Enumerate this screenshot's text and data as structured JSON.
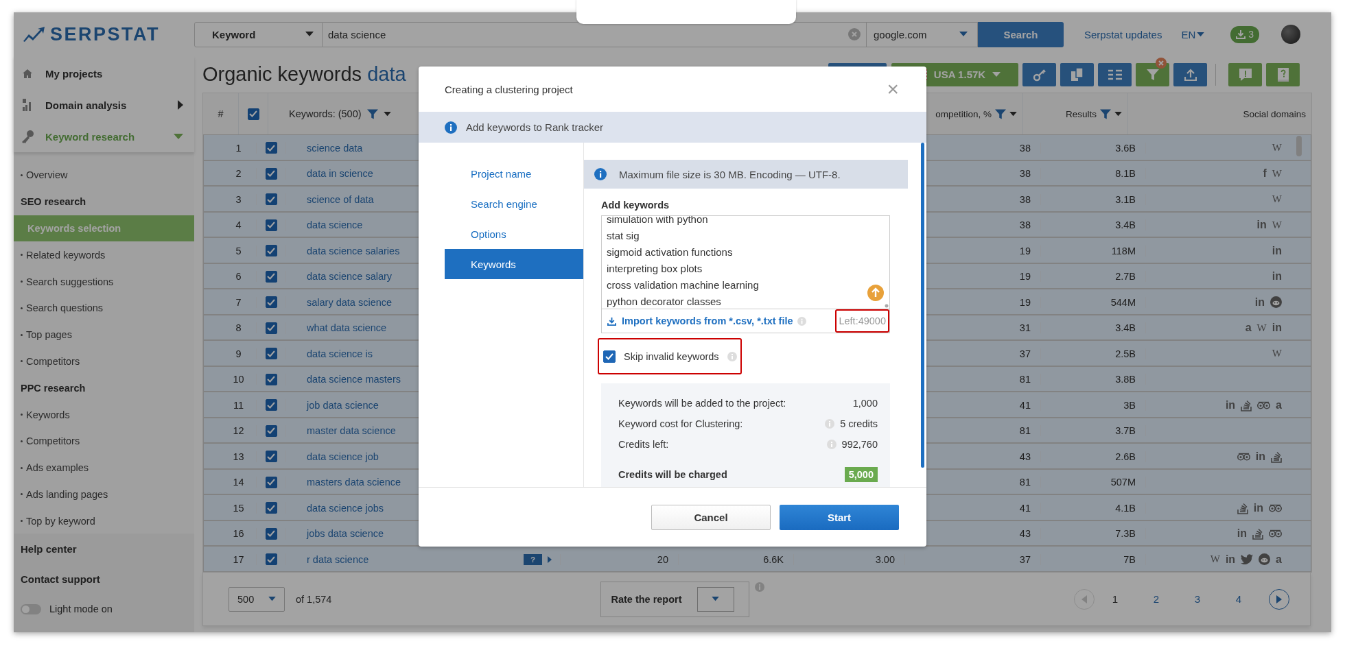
{
  "header": {
    "logo": "SERPSTAT",
    "search_type": "Keyword",
    "query": "data science",
    "engine": "google.com",
    "search_button": "Search",
    "updates_link": "Serpstat updates",
    "language": "EN",
    "downloads_count": "3"
  },
  "sidebar": {
    "items": [
      {
        "label": "My projects",
        "kind": "link",
        "expanded": false
      },
      {
        "label": "Domain analysis",
        "kind": "menu",
        "expanded": false
      },
      {
        "label": "Keyword research",
        "kind": "menu",
        "expanded": true
      }
    ],
    "subitems": [
      {
        "kind": "link",
        "label": "Overview",
        "selected": false
      },
      {
        "kind": "section",
        "label": "SEO research"
      },
      {
        "kind": "link",
        "label": "Keywords selection",
        "selected": true
      },
      {
        "kind": "link",
        "label": "Related keywords",
        "selected": false
      },
      {
        "kind": "link",
        "label": "Search suggestions",
        "selected": false
      },
      {
        "kind": "link",
        "label": "Search questions",
        "selected": false
      },
      {
        "kind": "link",
        "label": "Top pages",
        "selected": false
      },
      {
        "kind": "link",
        "label": "Competitors",
        "selected": false
      },
      {
        "kind": "section",
        "label": "PPC research"
      },
      {
        "kind": "link",
        "label": "Keywords",
        "selected": false
      },
      {
        "kind": "link",
        "label": "Competitors",
        "selected": false
      },
      {
        "kind": "link",
        "label": "Ads examples",
        "selected": false
      },
      {
        "kind": "link",
        "label": "Ads landing pages",
        "selected": false
      },
      {
        "kind": "link",
        "label": "Top by keyword",
        "selected": false
      }
    ],
    "bottom_links": [
      "Help center",
      "Contact support"
    ],
    "light_mode": {
      "label": "Light mode on",
      "on": false
    }
  },
  "page": {
    "title": "Organic keywords",
    "title_query": "data",
    "toolbar": [
      {
        "kind": "tool",
        "active": false,
        "removable": false
      },
      {
        "kind": "region",
        "label": "USA 1.57K",
        "active": true,
        "removable": false
      },
      {
        "kind": "tool",
        "active": false,
        "removable": false
      },
      {
        "kind": "tool",
        "active": false,
        "removable": false
      },
      {
        "kind": "tool",
        "active": false,
        "removable": false
      },
      {
        "kind": "tool",
        "active": true,
        "removable": true
      },
      {
        "kind": "tool",
        "active": false,
        "removable": false
      },
      {
        "kind": "support",
        "active": true,
        "removable": false
      },
      {
        "kind": "support",
        "active": true,
        "removable": false
      }
    ]
  },
  "table": {
    "columns": {
      "number": "#",
      "all_checked": true,
      "keywords": "Keywords: (500)",
      "competition": "ompetition, %",
      "results": "Results",
      "social": "Social domains"
    },
    "rows": [
      {
        "n": "1",
        "checked": true,
        "keyword": "science data",
        "competition": "38",
        "results": "3.6B",
        "social": [
          {
            "kind": "letter",
            "text": "W"
          }
        ]
      },
      {
        "n": "2",
        "checked": true,
        "keyword": "data in science",
        "competition": "38",
        "results": "8.1B",
        "social": [
          {
            "kind": "letter",
            "text": "f"
          },
          {
            "kind": "letter",
            "text": "W"
          }
        ]
      },
      {
        "n": "3",
        "checked": true,
        "keyword": "science of data",
        "competition": "38",
        "results": "3.1B",
        "social": [
          {
            "kind": "letter",
            "text": "W"
          }
        ]
      },
      {
        "n": "4",
        "checked": true,
        "keyword": "data science",
        "competition": "38",
        "results": "3.4B",
        "social": [
          {
            "kind": "letter",
            "text": "in"
          },
          {
            "kind": "letter",
            "text": "W"
          }
        ]
      },
      {
        "n": "5",
        "checked": true,
        "keyword": "data science salaries",
        "competition": "19",
        "results": "118M",
        "social": [
          {
            "kind": "letter",
            "text": "in"
          }
        ]
      },
      {
        "n": "6",
        "checked": true,
        "keyword": "data science salary",
        "competition": "19",
        "results": "2.7B",
        "social": [
          {
            "kind": "letter",
            "text": "in"
          }
        ]
      },
      {
        "n": "7",
        "checked": true,
        "keyword": "salary data science",
        "competition": "19",
        "results": "544M",
        "social": [
          {
            "kind": "letter",
            "text": "in"
          },
          {
            "kind": "alien"
          }
        ]
      },
      {
        "n": "8",
        "checked": true,
        "keyword": "what data science",
        "competition": "31",
        "results": "3.4B",
        "social": [
          {
            "kind": "letter",
            "text": "a"
          },
          {
            "kind": "letter",
            "text": "W"
          },
          {
            "kind": "letter",
            "text": "in"
          }
        ]
      },
      {
        "n": "9",
        "checked": true,
        "keyword": "data science is",
        "competition": "37",
        "results": "2.5B",
        "social": [
          {
            "kind": "letter",
            "text": "W"
          }
        ]
      },
      {
        "n": "10",
        "checked": true,
        "keyword": "data science masters",
        "competition": "81",
        "results": "3.8B"
      },
      {
        "n": "11",
        "checked": true,
        "keyword": "job data science",
        "competition": "41",
        "results": "3B",
        "social": [
          {
            "kind": "letter",
            "text": "in"
          },
          {
            "kind": "stack"
          },
          {
            "kind": "owl"
          },
          {
            "kind": "letter",
            "text": "a"
          }
        ]
      },
      {
        "n": "12",
        "checked": true,
        "keyword": "master data science",
        "competition": "81",
        "results": "3.7B"
      },
      {
        "n": "13",
        "checked": true,
        "keyword": "data science job",
        "competition": "43",
        "results": "2.6B",
        "social": [
          {
            "kind": "owl"
          },
          {
            "kind": "letter",
            "text": "in"
          },
          {
            "kind": "stack"
          }
        ]
      },
      {
        "n": "14",
        "checked": true,
        "keyword": "masters data science",
        "competition": "81",
        "results": "507M"
      },
      {
        "n": "15",
        "checked": true,
        "keyword": "data science jobs",
        "competition": "41",
        "results": "4.1B",
        "social": [
          {
            "kind": "stack"
          },
          {
            "kind": "letter",
            "text": "in"
          },
          {
            "kind": "owl"
          }
        ]
      },
      {
        "n": "16",
        "checked": true,
        "keyword": "jobs data science",
        "competition": "43",
        "results": "7.3B",
        "social": [
          {
            "kind": "letter",
            "text": "in"
          },
          {
            "kind": "stack"
          },
          {
            "kind": "owl"
          }
        ]
      },
      {
        "n": "17",
        "checked": true,
        "keyword": "r data science",
        "badge": "?",
        "column_4": "20",
        "column_5": "6.6K",
        "column_6": "3.00",
        "competition": "37",
        "results": "7B",
        "social": [
          {
            "kind": "letter",
            "text": "W"
          },
          {
            "kind": "letter",
            "text": "in"
          },
          {
            "kind": "bird"
          },
          {
            "kind": "alien"
          },
          {
            "kind": "letter",
            "text": "a"
          }
        ]
      }
    ]
  },
  "footer": {
    "page_size": "500",
    "total": "of 1,574",
    "rate_label": "Rate the report",
    "pages": [
      {
        "label": "1",
        "selected": true
      },
      {
        "label": "2",
        "selected": false
      },
      {
        "label": "3",
        "selected": false
      },
      {
        "label": "4",
        "selected": false
      }
    ],
    "prev_disabled": true
  },
  "modal": {
    "title": "Creating a clustering project",
    "close": "×",
    "notice": "Add keywords to Rank tracker",
    "steps": [
      {
        "label": "Project name",
        "selected": false
      },
      {
        "label": "Search engine",
        "selected": false
      },
      {
        "label": "Options",
        "selected": false
      },
      {
        "label": "Keywords",
        "selected": true
      }
    ],
    "file_note": "Maximum file size is 30 MB. Encoding — UTF-8.",
    "field_label": "Add keywords",
    "keywords": [
      "simulation with python",
      "stat sig",
      "sigmoid activation functions",
      "interpreting box plots",
      "cross validation machine learning",
      "python decorator classes"
    ],
    "import_link": "Import keywords from *.csv, *.txt file",
    "left_counter": {
      "text": "Left:49000",
      "highlighted": true
    },
    "skip_invalid": {
      "label": "Skip invalid keywords",
      "checked": true,
      "highlighted": true
    },
    "summary": [
      {
        "label": "Keywords will be added to the project:",
        "value": "1,000",
        "info": false
      },
      {
        "label": "Keyword cost for Clustering:",
        "value": "5 credits",
        "info": true
      },
      {
        "label": "Credits left:",
        "value": "992,760",
        "info": true
      }
    ],
    "charge": {
      "label": "Credits will be charged",
      "value": "5,000"
    },
    "buttons": [
      {
        "label": "Cancel",
        "kind": "secondary"
      },
      {
        "label": "Start",
        "kind": "primary"
      }
    ]
  }
}
